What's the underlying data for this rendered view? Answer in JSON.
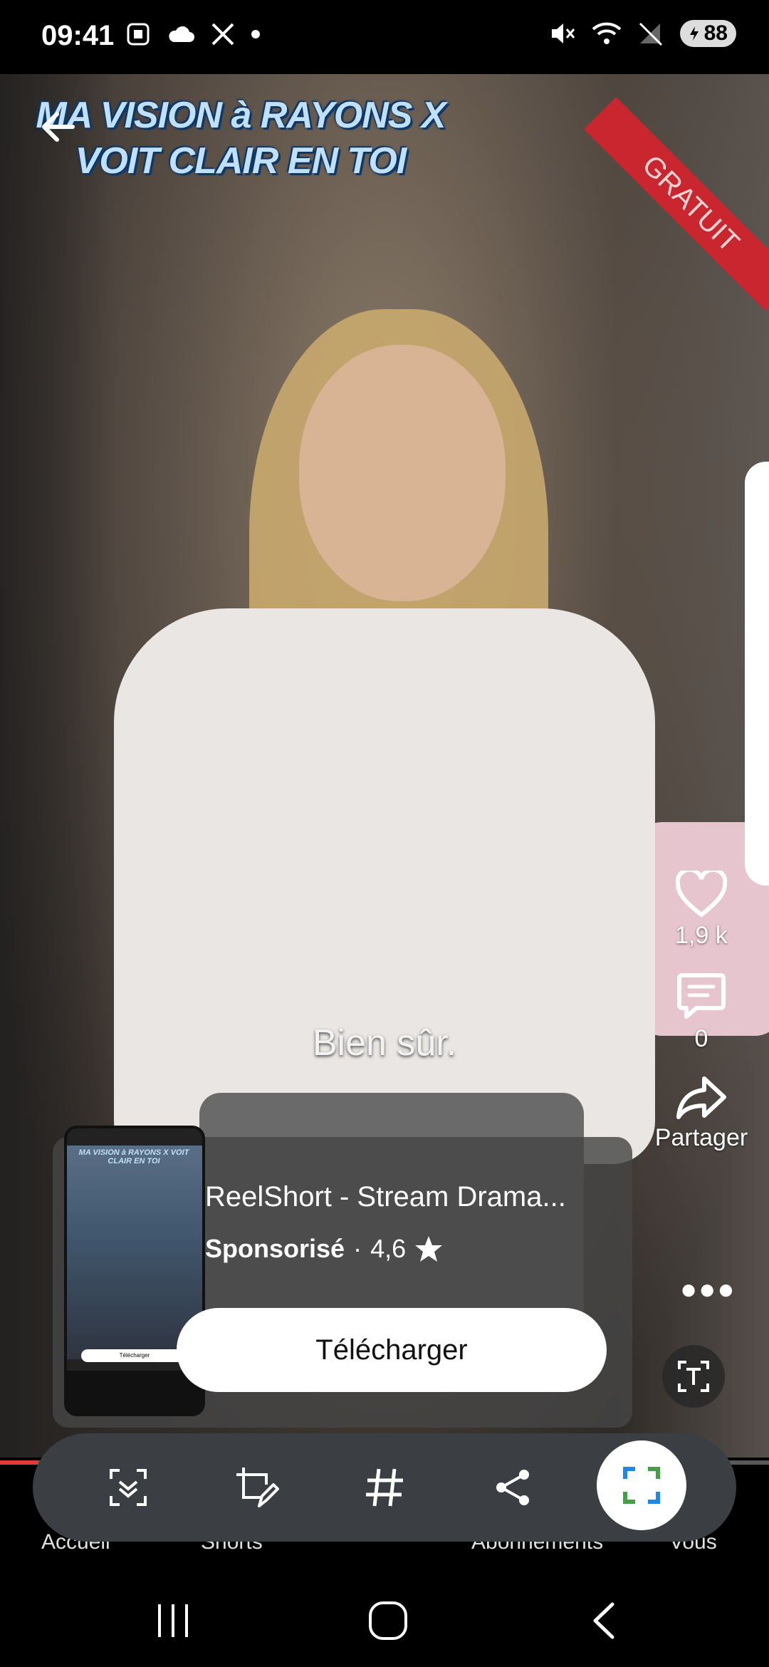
{
  "status_bar": {
    "time": "09:41",
    "battery": "88",
    "left_icons": [
      "screenshot-icon",
      "cloud-icon",
      "x-logo-icon",
      "dot-icon"
    ],
    "right_icons": [
      "mute-icon",
      "wifi-icon",
      "no-signal-icon",
      "battery-icon"
    ]
  },
  "video": {
    "title_line1": "MA VISION à RAYONS X",
    "title_line2": "VOIT CLAIR EN TOI",
    "ribbon": "GRATUIT",
    "subtitle": "Bien sûr.",
    "progress_fraction": 0.05
  },
  "actions": {
    "likes": "1,9 k",
    "comments": "0",
    "share": "Partager"
  },
  "ad": {
    "app_name": "ReelShort - Stream Drama...",
    "sponsored": "Sponsorisé",
    "separator": "·",
    "rating": "4,6",
    "download": "Télécharger",
    "thumb_title": "MA VISION à RAYONS X VOIT CLAIR EN TOI",
    "thumb_download": "Télécharger"
  },
  "tabbar": {
    "home": "Accueil",
    "shorts": "Shorts",
    "subscriptions": "Abonnements",
    "you": "Vous"
  },
  "screenshot_toolbar": {
    "tools": [
      "scroll-capture-icon",
      "edit-crop-icon",
      "hashtag-icon",
      "share-icon",
      "capture-frame-icon"
    ]
  },
  "colors": {
    "accent_red": "#e53935",
    "ribbon_red": "#c9262f"
  }
}
